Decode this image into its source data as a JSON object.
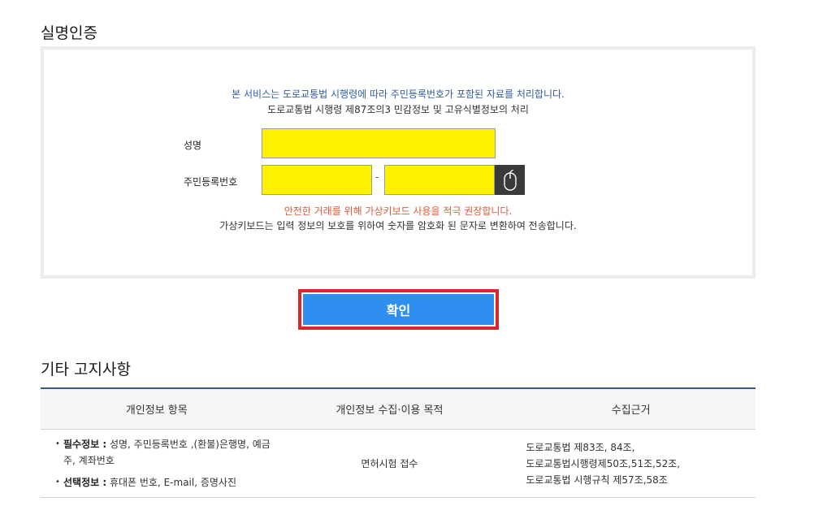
{
  "auth": {
    "section_title": "실명인증",
    "notice_blue": "본 서비스는 도로교통법 시행령에 따라 주민등록번호가 포함된 자료를 처리합니다.",
    "notice_grey": "도로교통법 시행령 제87조의3 민감정보 및 고유식별정보의 처리",
    "name_label": "성명",
    "name_value": "",
    "rrn_label": "주민등록번호",
    "rrn_front_value": "",
    "rrn_back_value": "",
    "rrn_separator": "-",
    "keyboard_icon": "mouse-icon",
    "notice_red": "안전한 거래를 위해 가상키보드 사용을 적극 권장합니다.",
    "notice_grey2": "가상키보드는 입력 정보의 보호를 위하여 숫자를 암호화 된 문자로 변환하여 전송합니다.",
    "confirm_label": "확인"
  },
  "other": {
    "section_title": "기타 고지사항",
    "columns": [
      "개인정보 항목",
      "개인정보 수집·이용 목적",
      "수집근거"
    ],
    "rows": [
      {
        "items": [
          {
            "label": "필수정보 :",
            "text": " 성명, 주민등록번호 ,(환불)은행명, 예금주, 계좌번호"
          },
          {
            "label": "선택정보 :",
            "text": " 휴대폰 번호, E-mail, 증명사진"
          }
        ],
        "purpose": "면허시험 접수",
        "basis": [
          "도로교통법 제83조, 84조,",
          "도로교통법시행령제50조,51조,52조,",
          "도로교통법 시행규칙 제57조,58조"
        ]
      }
    ]
  },
  "colors": {
    "input_bg": "#fff200",
    "confirm_bg": "#2f8ff0",
    "confirm_outline": "#d8262f",
    "notice_blue": "#2f5d9e",
    "notice_red": "#e05a3a",
    "table_top_border": "#3b5a85"
  }
}
